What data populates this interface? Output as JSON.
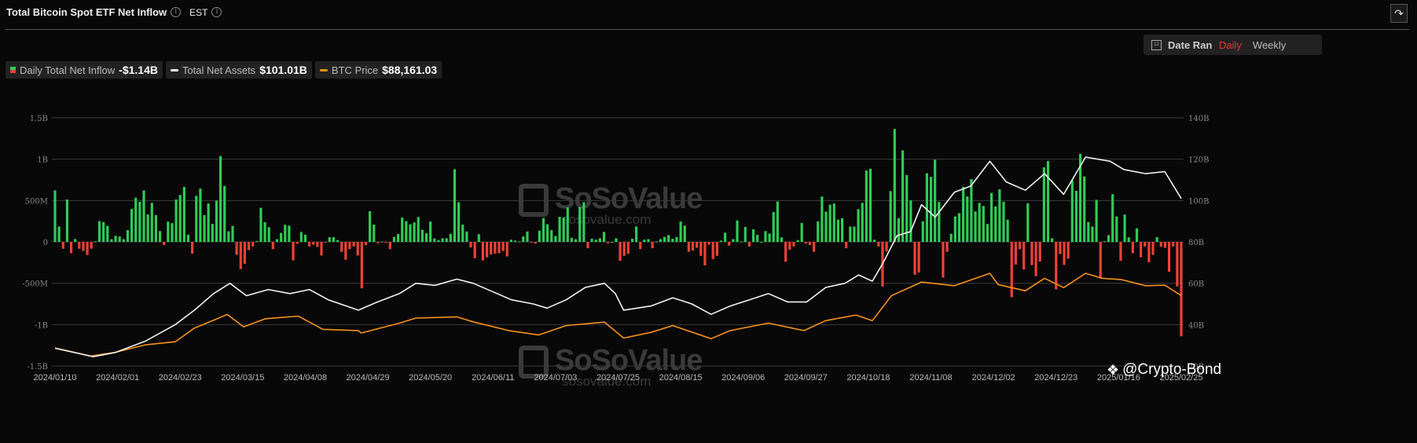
{
  "header": {
    "title": "Total Bitcoin Spot ETF Net Inflow",
    "timezone": "EST"
  },
  "controls": {
    "daily": "Daily",
    "weekly": "Weekly",
    "date_range": "Date Range",
    "calendar_day": "12",
    "active": "Daily"
  },
  "legend": [
    {
      "label": "Daily Total Net Inflow",
      "value": "-$1.14B"
    },
    {
      "label": "Total Net Assets",
      "value": "$101.01B"
    },
    {
      "label": "BTC Price",
      "value": "$88,161.03"
    }
  ],
  "watermark": {
    "brand": "SoSoValue",
    "site": "sosovalue.com"
  },
  "credit": "@Crypto-Bond",
  "colors": {
    "inflow": "#2fcc55",
    "outflow": "#ef4136",
    "assets": "#f2f2f2",
    "price": "#f7931a",
    "accent": "#e8362f"
  },
  "chart_data": {
    "type": "bar+line",
    "title": "Total Bitcoin Spot ETF Net Inflow",
    "left_axis": {
      "label": "Daily Total Net Inflow",
      "unit": "USD",
      "ticks": [
        "1.5B",
        "1B",
        "500M",
        "0",
        "-500M",
        "-1B",
        "-1.5B"
      ],
      "range_millions": [
        -1500,
        1500
      ]
    },
    "right_axis": {
      "label": "Total Net Assets",
      "ticks": [
        "140B",
        "120B",
        "100B",
        "80B",
        "60B",
        "40B",
        "20B"
      ],
      "range_billions": [
        20,
        140
      ]
    },
    "price_axis": {
      "hidden": true,
      "range_usd": [
        31500,
        231000
      ]
    },
    "x_ticks": [
      "2024/01/10",
      "2024/02/01",
      "2024/02/23",
      "2024/03/15",
      "2024/04/08",
      "2024/04/29",
      "2024/05/20",
      "2024/06/11",
      "2024/07/03",
      "2024/07/25",
      "2024/08/15",
      "2024/09/06",
      "2024/09/27",
      "2024/10/18",
      "2024/11/08",
      "2024/12/02",
      "2024/12/23",
      "2025/01/16",
      "2025/02/25"
    ],
    "x_range": [
      "2024-01-10",
      "2025-02-25"
    ],
    "grid": true,
    "inflow_millions": [
      623,
      186,
      -82,
      513,
      -136,
      35,
      -82,
      -109,
      -158,
      -82,
      8,
      251,
      240,
      194,
      33,
      74,
      66,
      33,
      142,
      399,
      535,
      486,
      622,
      333,
      472,
      325,
      131,
      -38,
      246,
      227,
      513,
      568,
      666,
      87,
      -142,
      557,
      644,
      325,
      464,
      218,
      500,
      1037,
      677,
      128,
      194,
      -156,
      -328,
      -265,
      -98,
      -55,
      11,
      412,
      238,
      177,
      -87,
      33,
      109,
      207,
      197,
      -224,
      -22,
      120,
      87,
      -55,
      -33,
      -60,
      -164,
      -5,
      57,
      57,
      22,
      -120,
      -216,
      -87,
      -55,
      -164,
      -560,
      -38,
      371,
      210,
      -16,
      5,
      -11,
      -87,
      60,
      96,
      295,
      251,
      213,
      235,
      300,
      147,
      104,
      246,
      41,
      22,
      44,
      44,
      98,
      879,
      480,
      210,
      126,
      -66,
      -197,
      93,
      -224,
      -186,
      -153,
      -142,
      -136,
      -109,
      -175,
      27,
      16,
      5,
      66,
      126,
      -11,
      -19,
      136,
      289,
      213,
      142,
      71,
      303,
      295,
      418,
      49,
      33,
      423,
      480,
      -76,
      38,
      27,
      44,
      120,
      -16,
      0,
      44,
      -229,
      -169,
      -142,
      38,
      186,
      -87,
      27,
      33,
      -76,
      5,
      33,
      60,
      82,
      38,
      60,
      246,
      197,
      -120,
      -104,
      -71,
      -169,
      -284,
      -33,
      -207,
      -169,
      16,
      112,
      -44,
      33,
      259,
      5,
      180,
      -55,
      153,
      85,
      0,
      131,
      101,
      360,
      489,
      55,
      -240,
      -93,
      -55,
      22,
      229,
      -19,
      -38,
      -120,
      248,
      549,
      366,
      450,
      464,
      270,
      287,
      -76,
      186,
      186,
      396,
      472,
      863,
      885,
      27,
      -55,
      -538,
      -115,
      614,
      1365,
      287,
      1106,
      808,
      502,
      -396,
      -369,
      248,
      830,
      786,
      994,
      483,
      -431,
      -120,
      98,
      308,
      347,
      666,
      549,
      759,
      369,
      472,
      434,
      216,
      592,
      429,
      636,
      486,
      270,
      -669,
      -273,
      -87,
      -333,
      467,
      -281,
      -415,
      -238,
      901,
      977,
      44,
      -573,
      -147,
      -278,
      -202,
      743,
      617,
      1065,
      792,
      240,
      186,
      508,
      -442,
      8,
      82,
      576,
      308,
      -229,
      330,
      55,
      -136,
      164,
      -186,
      -55,
      -246,
      -156,
      57,
      -60,
      -71,
      -360,
      -55,
      -538,
      -1140
    ],
    "total_net_assets_billions": [
      [
        "2024-01-10",
        28.6
      ],
      [
        "2024-01-24",
        24.5
      ],
      [
        "2024-02-01",
        26.5
      ],
      [
        "2024-02-12",
        32
      ],
      [
        "2024-02-23",
        40
      ],
      [
        "2024-03-01",
        47
      ],
      [
        "2024-03-08",
        55
      ],
      [
        "2024-03-14",
        60
      ],
      [
        "2024-03-20",
        54
      ],
      [
        "2024-03-28",
        57
      ],
      [
        "2024-04-05",
        55
      ],
      [
        "2024-04-12",
        57
      ],
      [
        "2024-04-19",
        52
      ],
      [
        "2024-04-30",
        47
      ],
      [
        "2024-05-07",
        51
      ],
      [
        "2024-05-15",
        55
      ],
      [
        "2024-05-21",
        60
      ],
      [
        "2024-05-28",
        59
      ],
      [
        "2024-06-05",
        62
      ],
      [
        "2024-06-11",
        60
      ],
      [
        "2024-06-18",
        56
      ],
      [
        "2024-06-25",
        52
      ],
      [
        "2024-07-03",
        50
      ],
      [
        "2024-07-08",
        48
      ],
      [
        "2024-07-15",
        52
      ],
      [
        "2024-07-22",
        58
      ],
      [
        "2024-07-29",
        60
      ],
      [
        "2024-08-02",
        55
      ],
      [
        "2024-08-05",
        47
      ],
      [
        "2024-08-15",
        49
      ],
      [
        "2024-08-23",
        53
      ],
      [
        "2024-08-30",
        50
      ],
      [
        "2024-09-06",
        45
      ],
      [
        "2024-09-13",
        49
      ],
      [
        "2024-09-20",
        52
      ],
      [
        "2024-09-27",
        55
      ],
      [
        "2024-10-04",
        51
      ],
      [
        "2024-10-11",
        51
      ],
      [
        "2024-10-18",
        58
      ],
      [
        "2024-10-25",
        60
      ],
      [
        "2024-10-30",
        64
      ],
      [
        "2024-11-04",
        61
      ],
      [
        "2024-11-08",
        70
      ],
      [
        "2024-11-13",
        83
      ],
      [
        "2024-11-18",
        85
      ],
      [
        "2024-11-22",
        98
      ],
      [
        "2024-11-27",
        92
      ],
      [
        "2024-12-04",
        104
      ],
      [
        "2024-12-10",
        107
      ],
      [
        "2024-12-17",
        119
      ],
      [
        "2024-12-23",
        109
      ],
      [
        "2024-12-30",
        105
      ],
      [
        "2025-01-06",
        113
      ],
      [
        "2025-01-13",
        103
      ],
      [
        "2025-01-21",
        121
      ],
      [
        "2025-01-30",
        119
      ],
      [
        "2025-02-04",
        115
      ],
      [
        "2025-02-12",
        113
      ],
      [
        "2025-02-19",
        114
      ],
      [
        "2025-02-25",
        101.01
      ]
    ],
    "btc_price_usd": [
      [
        "2024-01-10",
        46000
      ],
      [
        "2024-01-23",
        39500
      ],
      [
        "2024-02-01",
        42500
      ],
      [
        "2024-02-12",
        48500
      ],
      [
        "2024-02-23",
        51000
      ],
      [
        "2024-03-01",
        62000
      ],
      [
        "2024-03-08",
        68300
      ],
      [
        "2024-03-13",
        73000
      ],
      [
        "2024-03-19",
        63000
      ],
      [
        "2024-03-27",
        69500
      ],
      [
        "2024-04-08",
        71600
      ],
      [
        "2024-04-17",
        61000
      ],
      [
        "2024-04-30",
        60000
      ],
      [
        "2024-05-01",
        58000
      ],
      [
        "2024-05-15",
        66000
      ],
      [
        "2024-05-21",
        70000
      ],
      [
        "2024-06-05",
        71000
      ],
      [
        "2024-06-11",
        67000
      ],
      [
        "2024-06-24",
        60000
      ],
      [
        "2024-07-05",
        56500
      ],
      [
        "2024-07-15",
        64000
      ],
      [
        "2024-07-29",
        66800
      ],
      [
        "2024-08-05",
        54000
      ],
      [
        "2024-08-15",
        58500
      ],
      [
        "2024-08-23",
        64000
      ],
      [
        "2024-09-06",
        53500
      ],
      [
        "2024-09-13",
        60000
      ],
      [
        "2024-09-27",
        66000
      ],
      [
        "2024-10-10",
        60000
      ],
      [
        "2024-10-18",
        68000
      ],
      [
        "2024-10-29",
        72500
      ],
      [
        "2024-11-04",
        68000
      ],
      [
        "2024-11-11",
        88000
      ],
      [
        "2024-11-13",
        90000
      ],
      [
        "2024-11-22",
        99000
      ],
      [
        "2024-12-04",
        96000
      ],
      [
        "2024-12-17",
        106000
      ],
      [
        "2024-12-20",
        97000
      ],
      [
        "2024-12-30",
        92000
      ],
      [
        "2025-01-06",
        102000
      ],
      [
        "2025-01-13",
        94500
      ],
      [
        "2025-01-21",
        106000
      ],
      [
        "2025-01-27",
        102000
      ],
      [
        "2025-02-03",
        101000
      ],
      [
        "2025-02-12",
        96000
      ],
      [
        "2025-02-19",
        96500
      ],
      [
        "2025-02-25",
        88161.03
      ]
    ]
  }
}
